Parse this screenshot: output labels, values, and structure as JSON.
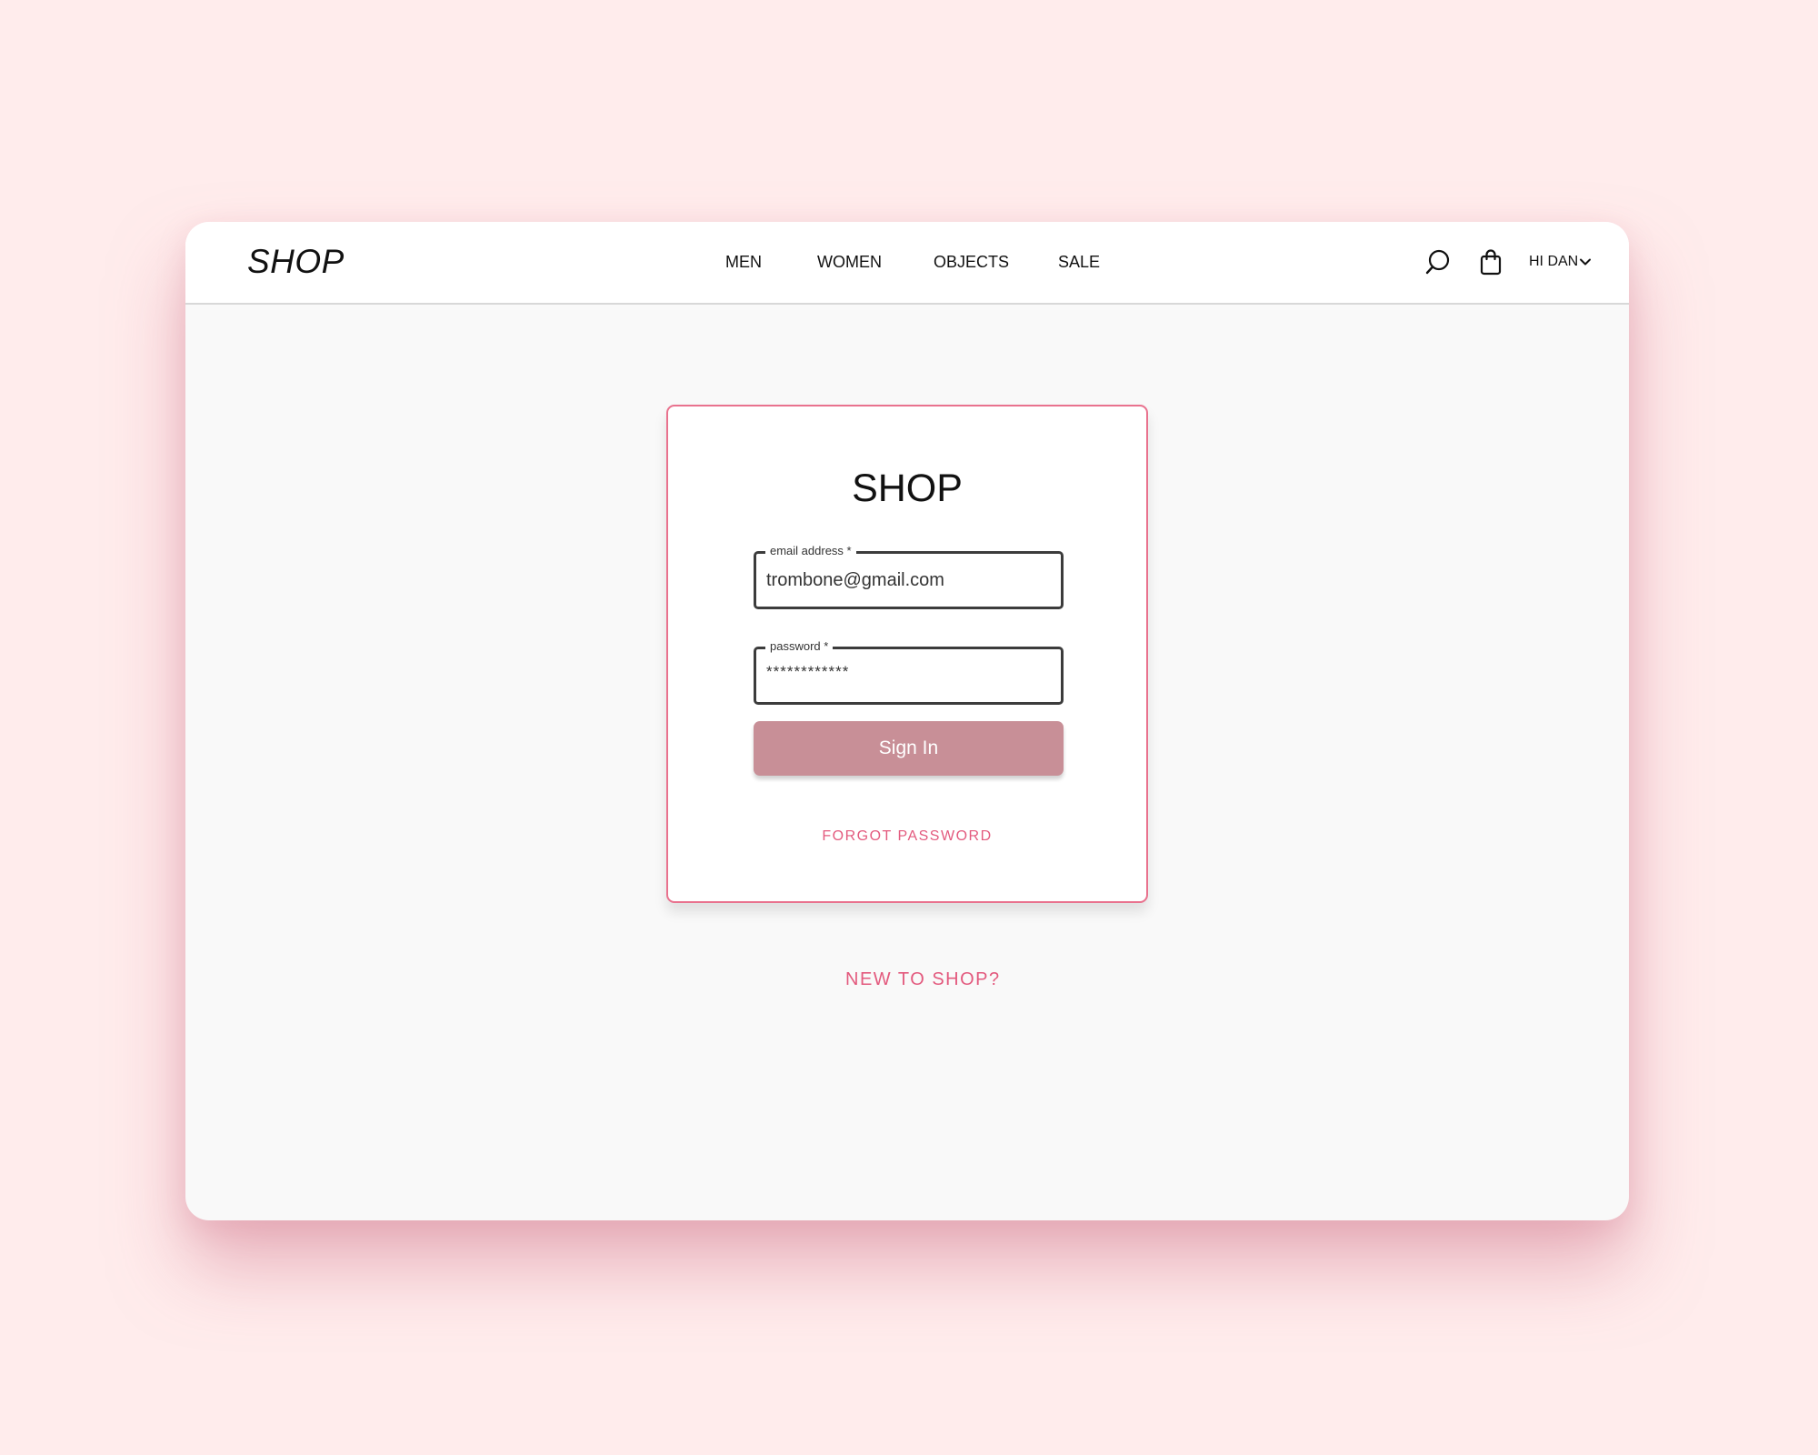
{
  "colors": {
    "page_background": "#ffecec",
    "accent": "#e35a7e",
    "card_border": "#e9728e",
    "button": "#c88f97",
    "text": "#111111"
  },
  "header": {
    "logo": "SHOP",
    "nav": [
      {
        "label": "MEN"
      },
      {
        "label": "WOMEN"
      },
      {
        "label": "OBJECTS"
      },
      {
        "label": "SALE"
      }
    ],
    "icons": [
      "search-icon",
      "shopping-bag-icon",
      "chevron-down-icon"
    ],
    "user_menu_label": "HI DAN"
  },
  "login": {
    "title": "SHOP",
    "email": {
      "label": "email address *",
      "value": "trombone@gmail.com"
    },
    "password": {
      "label": "password *",
      "value": "************"
    },
    "sign_in_label": "Sign In",
    "forgot_password_label": "FORGOT PASSWORD"
  },
  "signup": {
    "new_user_label": "NEW TO SHOP?"
  }
}
